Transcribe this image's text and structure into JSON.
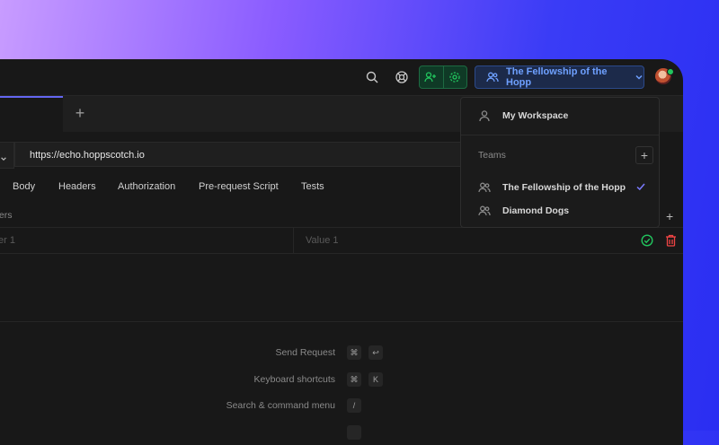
{
  "workspace": {
    "current_team": "The Fellowship of the Hopp",
    "menu": {
      "my_workspace": "My Workspace",
      "teams_label": "Teams",
      "teams": [
        {
          "name": "The Fellowship of the Hopp",
          "selected": true
        },
        {
          "name": "Diamond Dogs",
          "selected": false
        }
      ]
    }
  },
  "tabs": {
    "add_label": "+"
  },
  "request": {
    "url": "https://echo.hoppscotch.io",
    "tabs": [
      "Body",
      "Headers",
      "Authorization",
      "Pre-request Script",
      "Tests"
    ],
    "params_label": "ters",
    "param_key_placeholder": "er 1",
    "param_value_placeholder": "Value 1"
  },
  "shortcuts": [
    {
      "label": "Send Request",
      "keys": [
        "⌘",
        "↩"
      ]
    },
    {
      "label": "Keyboard shortcuts",
      "keys": [
        "⌘",
        "K"
      ]
    },
    {
      "label": "Search & command menu",
      "keys": [
        "/"
      ]
    }
  ],
  "colors": {
    "accent": "#6366f1",
    "team_button": "#6ea0ff",
    "invite_green": "#22c55e",
    "delete_red": "#ef4444"
  },
  "icons": [
    "search-icon",
    "help-icon",
    "invite-user-icon",
    "settings-icon",
    "users-icon",
    "chevron-down-icon",
    "user-icon",
    "plus-icon",
    "check-icon",
    "check-circle-icon",
    "trash-icon",
    "avatar"
  ]
}
